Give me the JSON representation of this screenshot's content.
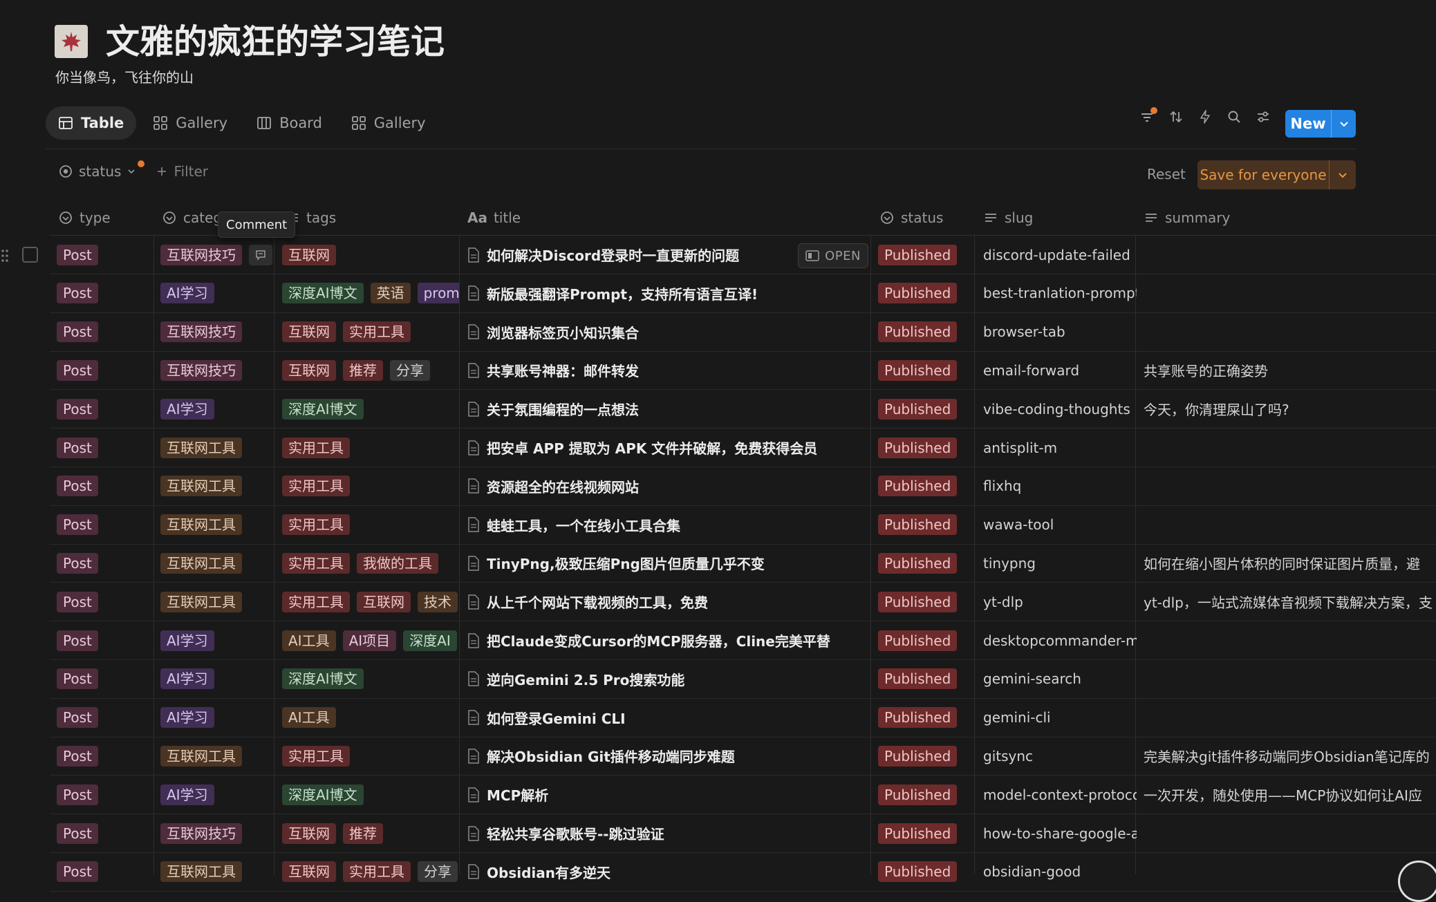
{
  "page": {
    "title": "文雅的疯狂的学习笔记",
    "subtitle": "你当像鸟，飞往你的山",
    "icon": "maple-leaf-icon"
  },
  "views": [
    {
      "label": "Table",
      "icon": "table-icon",
      "active": true
    },
    {
      "label": "Gallery",
      "icon": "gallery-icon",
      "active": false
    },
    {
      "label": "Board",
      "icon": "board-icon",
      "active": false
    },
    {
      "label": "Gallery",
      "icon": "gallery-icon",
      "active": false
    }
  ],
  "toolbar": {
    "new_label": "New",
    "reset_label": "Reset",
    "save_label": "Save for everyone"
  },
  "filters": {
    "status_label": "status",
    "filter_label": "Filter"
  },
  "tooltip": {
    "comment": "Comment"
  },
  "open_label": "OPEN",
  "columns": {
    "type": "type",
    "category": "categ",
    "tags": "tags",
    "title_prefix": "Aa",
    "title": "title",
    "status": "status",
    "slug": "slug",
    "summary": "summary"
  },
  "colors": {
    "accent": "#2383e2",
    "save_text": "#e5973e",
    "status_published": "#6e2b2b",
    "background": "#191919"
  },
  "rows": [
    {
      "type": "Post",
      "category": "互联网技巧",
      "tags": [
        "互联网"
      ],
      "title": "如何解决Discord登录时一直更新的问题",
      "status": "Published",
      "slug": "discord-update-failed",
      "summary": ""
    },
    {
      "type": "Post",
      "category": "AI学习",
      "tags": [
        "深度AI博文",
        "英语",
        "prom"
      ],
      "title": "新版最强翻译Prompt，支持所有语言互译!",
      "status": "Published",
      "slug": "best-tranlation-prompt",
      "summary": ""
    },
    {
      "type": "Post",
      "category": "互联网技巧",
      "tags": [
        "互联网",
        "实用工具"
      ],
      "title": "浏览器标签页小知识集合",
      "status": "Published",
      "slug": "browser-tab",
      "summary": ""
    },
    {
      "type": "Post",
      "category": "互联网技巧",
      "tags": [
        "互联网",
        "推荐",
        "分享"
      ],
      "title": "共享账号神器：邮件转发",
      "status": "Published",
      "slug": "email-forward",
      "summary": "共享账号的正确姿势"
    },
    {
      "type": "Post",
      "category": "AI学习",
      "tags": [
        "深度AI博文"
      ],
      "title": "关于氛围编程的一点想法",
      "status": "Published",
      "slug": "vibe-coding-thoughts",
      "summary": "今天，你清理屎山了吗?"
    },
    {
      "type": "Post",
      "category": "互联网工具",
      "tags": [
        "实用工具"
      ],
      "title": "把安卓 APP 提取为 APK 文件并破解，免费获得会员",
      "status": "Published",
      "slug": "antisplit-m",
      "summary": ""
    },
    {
      "type": "Post",
      "category": "互联网工具",
      "tags": [
        "实用工具"
      ],
      "title": "资源超全的在线视频网站",
      "status": "Published",
      "slug": "flixhq",
      "summary": ""
    },
    {
      "type": "Post",
      "category": "互联网工具",
      "tags": [
        "实用工具"
      ],
      "title": "蛙蛙工具，一个在线小工具合集",
      "status": "Published",
      "slug": "wawa-tool",
      "summary": ""
    },
    {
      "type": "Post",
      "category": "互联网工具",
      "tags": [
        "实用工具",
        "我做的工具"
      ],
      "title": "TinyPng,极致压缩Png图片但质量几乎不变",
      "status": "Published",
      "slug": "tinypng",
      "summary": "如何在缩小图片体积的同时保证图片质量，避"
    },
    {
      "type": "Post",
      "category": "互联网工具",
      "tags": [
        "实用工具",
        "互联网",
        "技术"
      ],
      "title": "从上千个网站下载视频的工具，免费",
      "status": "Published",
      "slug": "yt-dlp",
      "summary": "yt-dlp，一站式流媒体音视频下载解决方案，支"
    },
    {
      "type": "Post",
      "category": "AI学习",
      "tags": [
        "AI工具",
        "AI项目",
        "深度AI"
      ],
      "title": "把Claude变成Cursor的MCP服务器，Cline完美平替",
      "status": "Published",
      "slug": "desktopcommander-mc",
      "summary": ""
    },
    {
      "type": "Post",
      "category": "AI学习",
      "tags": [
        "深度AI博文"
      ],
      "title": "逆向Gemini 2.5 Pro搜索功能",
      "status": "Published",
      "slug": "gemini-search",
      "summary": ""
    },
    {
      "type": "Post",
      "category": "AI学习",
      "tags": [
        "AI工具"
      ],
      "title": "如何登录Gemini CLI",
      "status": "Published",
      "slug": "gemini-cli",
      "summary": ""
    },
    {
      "type": "Post",
      "category": "互联网工具",
      "tags": [
        "实用工具"
      ],
      "title": "解决Obsidian Git插件移动端同步难题",
      "status": "Published",
      "slug": "gitsync",
      "summary": "完美解决git插件移动端同步Obsidian笔记库的"
    },
    {
      "type": "Post",
      "category": "AI学习",
      "tags": [
        "深度AI博文"
      ],
      "title": "MCP解析",
      "status": "Published",
      "slug": "model-context-protoco",
      "summary": "一次开发，随处使用——MCP协议如何让AI应"
    },
    {
      "type": "Post",
      "category": "互联网技巧",
      "tags": [
        "互联网",
        "推荐"
      ],
      "title": "轻松共享谷歌账号--跳过验证",
      "status": "Published",
      "slug": "how-to-share-google-ac",
      "summary": ""
    },
    {
      "type": "Post",
      "category": "互联网工具",
      "tags": [
        "互联网",
        "实用工具",
        "分享"
      ],
      "title": "Obsidian有多逆天",
      "status": "Published",
      "slug": "obsidian-good",
      "summary": ""
    }
  ]
}
